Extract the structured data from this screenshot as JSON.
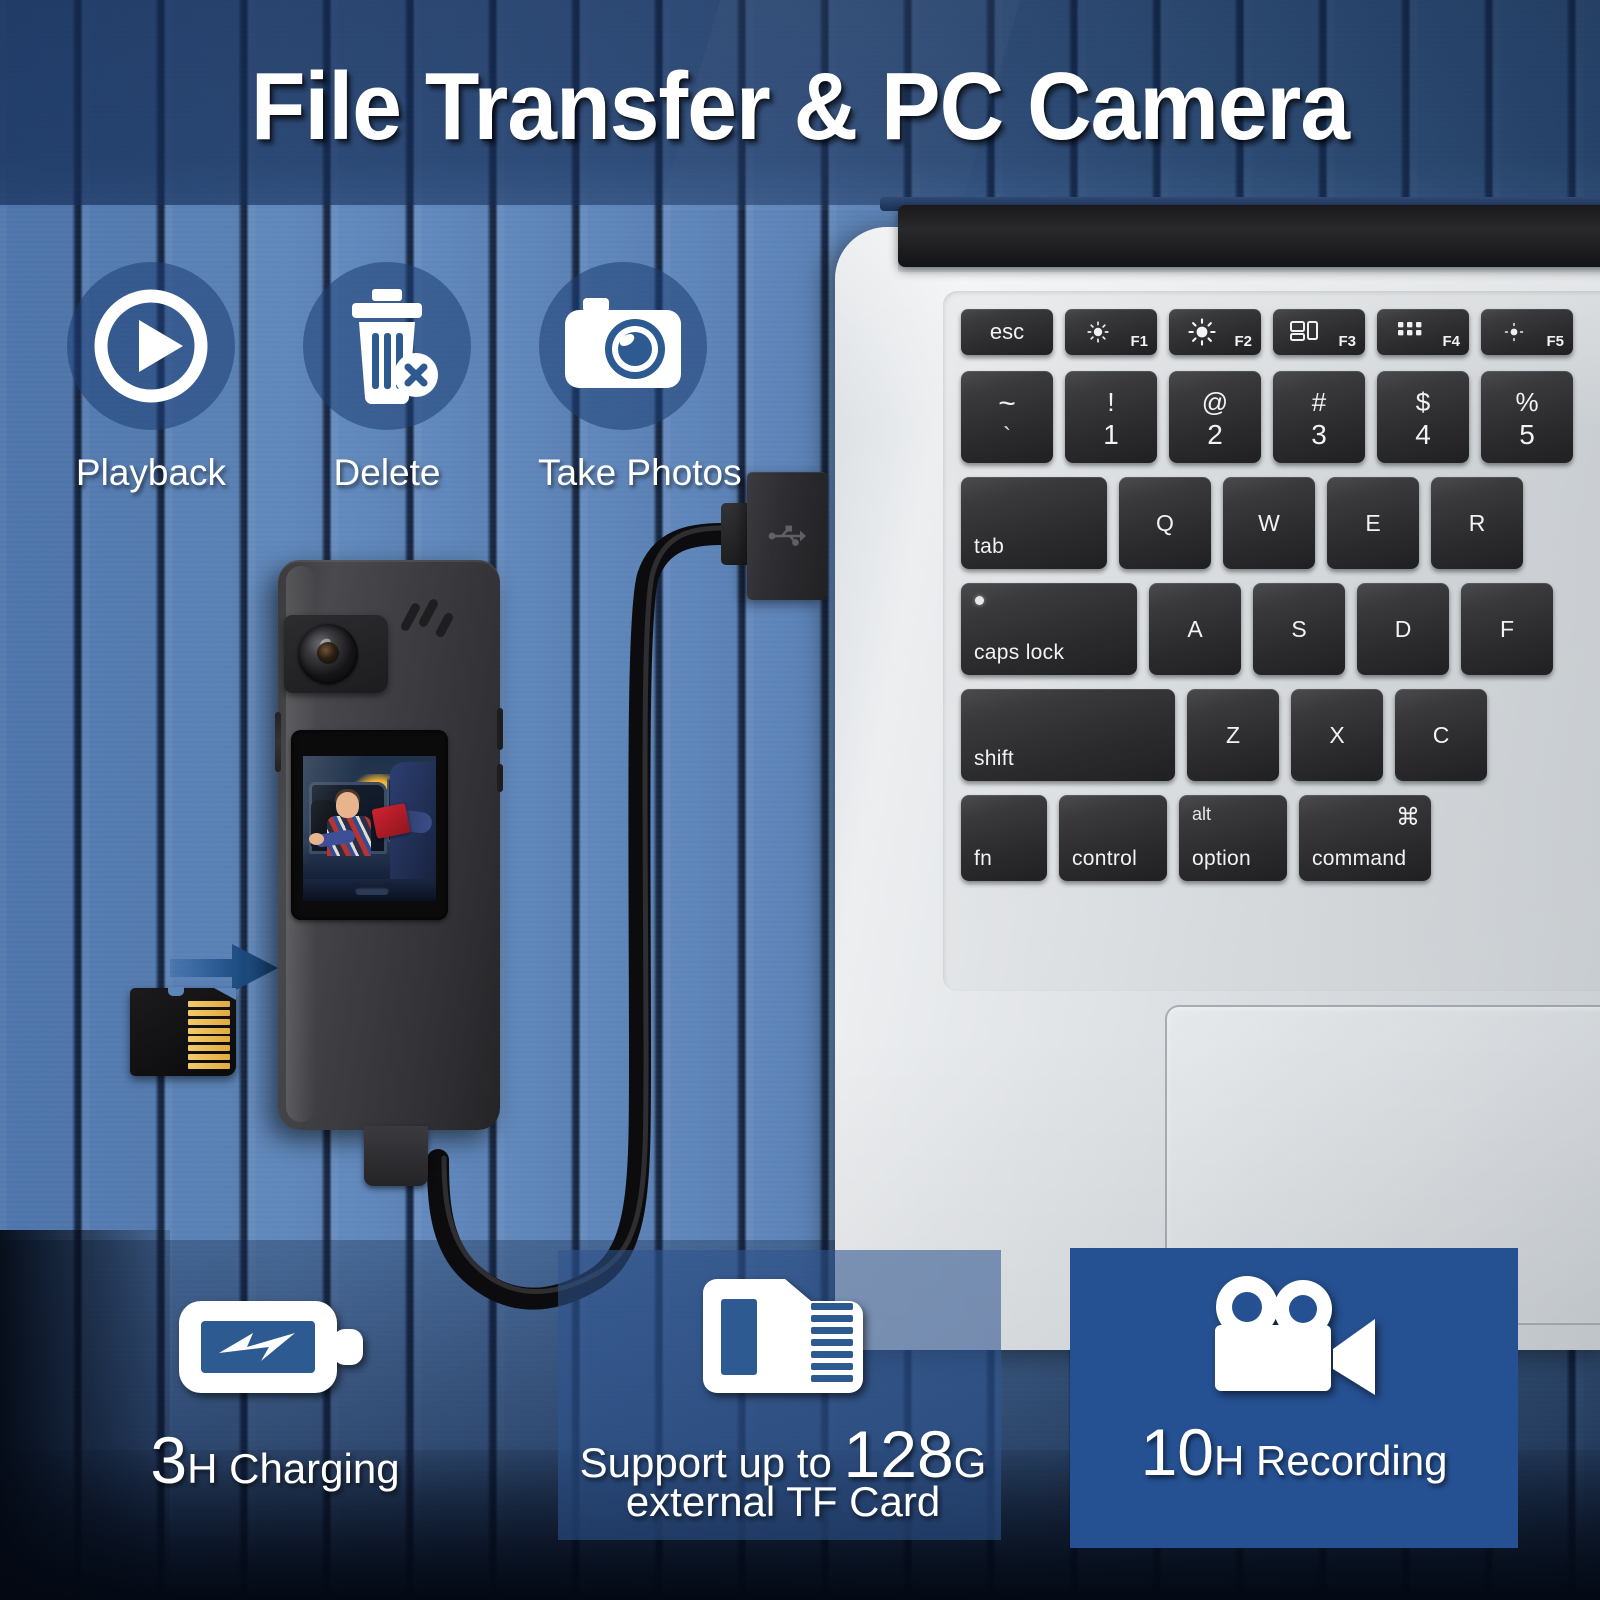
{
  "title": "File Transfer & PC Camera",
  "theme": {
    "wall_blue": "#5e85ba",
    "panel_blue": "#255091",
    "panel_blue_translucent": "rgba(46,84,143,0.58)",
    "icon_disc_blue": "rgba(28,62,115,0.55)",
    "accent_white": "#ffffff",
    "arrow_blue": "#1f4f86",
    "card_gold": "#e9b74c"
  },
  "features": [
    {
      "id": "playback",
      "label": "Playback",
      "icon": "play-circle-icon"
    },
    {
      "id": "delete",
      "label": "Delete",
      "icon": "trash-delete-icon"
    },
    {
      "id": "take-photos",
      "label": "Take Photos",
      "icon": "camera-icon"
    }
  ],
  "specs": [
    {
      "id": "charging",
      "icon": "battery-charging-icon",
      "value": "3",
      "unit": "H",
      "label": " Charging",
      "full_text": "3H Charging"
    },
    {
      "id": "tf-card",
      "icon": "micro-sd-card-icon",
      "lead": "Support up to ",
      "value": "128",
      "unit": "G",
      "line2": "external TF Card",
      "full_text": "Support up to 128G external TF Card"
    },
    {
      "id": "recording",
      "icon": "video-camera-icon",
      "value": "10",
      "unit": "H",
      "label": " Recording",
      "full_text": "10H Recording"
    }
  ],
  "device": {
    "name": "body-camera",
    "screen_scene": "traffic-stop-preview",
    "has_lens": true,
    "has_speaker_slashes": true,
    "memory_card": "micro-sd-card",
    "insert_arrow": "arrow-right-icon"
  },
  "cable": {
    "usb_a_connector": "usb-a-plug",
    "usb_logo": "usb-trident-icon",
    "usb_c_connector": "usb-c-plug"
  },
  "laptop": {
    "brand_style": "silver-macbook",
    "function_row": [
      {
        "label": "esc",
        "icon": "",
        "fn": ""
      },
      {
        "label": "",
        "icon": "brightness-low-icon",
        "fn": "F1"
      },
      {
        "label": "",
        "icon": "brightness-high-icon",
        "fn": "F2"
      },
      {
        "label": "",
        "icon": "mission-control-icon",
        "fn": "F3"
      },
      {
        "label": "",
        "icon": "launchpad-icon",
        "fn": "F4"
      },
      {
        "label": "",
        "icon": "brightness-keyboard-icon",
        "fn": "F5"
      }
    ],
    "number_row": [
      {
        "top": "~",
        "bottom": "`"
      },
      {
        "top": "!",
        "bottom": "1"
      },
      {
        "top": "@",
        "bottom": "2"
      },
      {
        "top": "#",
        "bottom": "3"
      },
      {
        "top": "$",
        "bottom": "4"
      },
      {
        "top": "%",
        "bottom": "5"
      }
    ],
    "qwerty_row": [
      {
        "label": "tab",
        "align": "bottom-left"
      },
      {
        "label": "Q",
        "align": "center"
      },
      {
        "label": "W",
        "align": "center"
      },
      {
        "label": "E",
        "align": "center"
      },
      {
        "label": "R",
        "align": "center"
      }
    ],
    "home_row": [
      {
        "label": "caps lock",
        "align": "bottom-left"
      },
      {
        "label": "A",
        "align": "center"
      },
      {
        "label": "S",
        "align": "center"
      },
      {
        "label": "D",
        "align": "center"
      },
      {
        "label": "F",
        "align": "center"
      }
    ],
    "shift_row": [
      {
        "label": "shift",
        "align": "bottom-left"
      },
      {
        "label": "Z",
        "align": "center"
      },
      {
        "label": "X",
        "align": "center"
      },
      {
        "label": "C",
        "align": "center"
      }
    ],
    "modifier_row": [
      {
        "label": "fn",
        "top": ""
      },
      {
        "label": "control",
        "top": ""
      },
      {
        "label": "option",
        "top": "alt"
      },
      {
        "label": "command",
        "top": "⌘"
      }
    ],
    "trackpad": "trackpad"
  }
}
